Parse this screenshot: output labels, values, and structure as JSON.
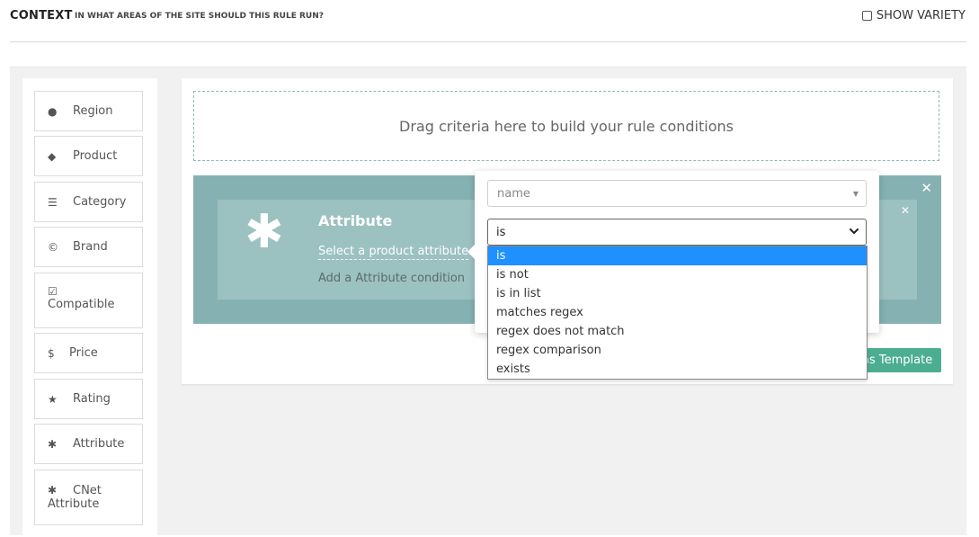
{
  "header": {
    "title": "CONTEXT",
    "subtitle": "IN WHAT AREAS OF THE SITE SHOULD THIS RULE RUN?",
    "show_variety_label": "SHOW VARIETY"
  },
  "sidebar": {
    "items": [
      {
        "label": "Region",
        "icon": "globe-icon",
        "glyph": "●"
      },
      {
        "label": "Product",
        "icon": "tag-icon",
        "glyph": "◆"
      },
      {
        "label": "Category",
        "icon": "list-icon",
        "glyph": "☰"
      },
      {
        "label": "Brand",
        "icon": "copyright-icon",
        "glyph": "©"
      },
      {
        "label": "Compatible",
        "icon": "check-square-icon",
        "glyph": "☑"
      },
      {
        "label": "Price",
        "icon": "dollar-icon",
        "glyph": "$"
      },
      {
        "label": "Rating",
        "icon": "star-icon",
        "glyph": "★"
      },
      {
        "label": "Attribute",
        "icon": "asterisk-icon",
        "glyph": "✱"
      },
      {
        "label": "CNet Attribute",
        "icon": "asterisk-icon",
        "glyph": "✱",
        "line1": "CNet",
        "line2": "Attribute"
      }
    ]
  },
  "dropzone": {
    "text": "Drag criteria here to build your rule conditions"
  },
  "rule": {
    "close_glyph": "✕",
    "card": {
      "title": "Attribute",
      "select_link": "Select a product attribute",
      "add_condition": "Add a Attribute condition",
      "close_glyph": "✕",
      "icon_glyph": "✱"
    }
  },
  "template_button": {
    "label": "as Template"
  },
  "popover": {
    "name_value": "name",
    "operator_value": "is",
    "operator_options": [
      "is",
      "is not",
      "is in list",
      "matches regex",
      "regex does not match",
      "regex comparison",
      "exists"
    ],
    "selected_index": 0
  },
  "colors": {
    "rule_bg": "#85b1b2",
    "card_bg": "#9cc1c1",
    "button": "#4cae91",
    "option_selected": "#1e90ff"
  }
}
